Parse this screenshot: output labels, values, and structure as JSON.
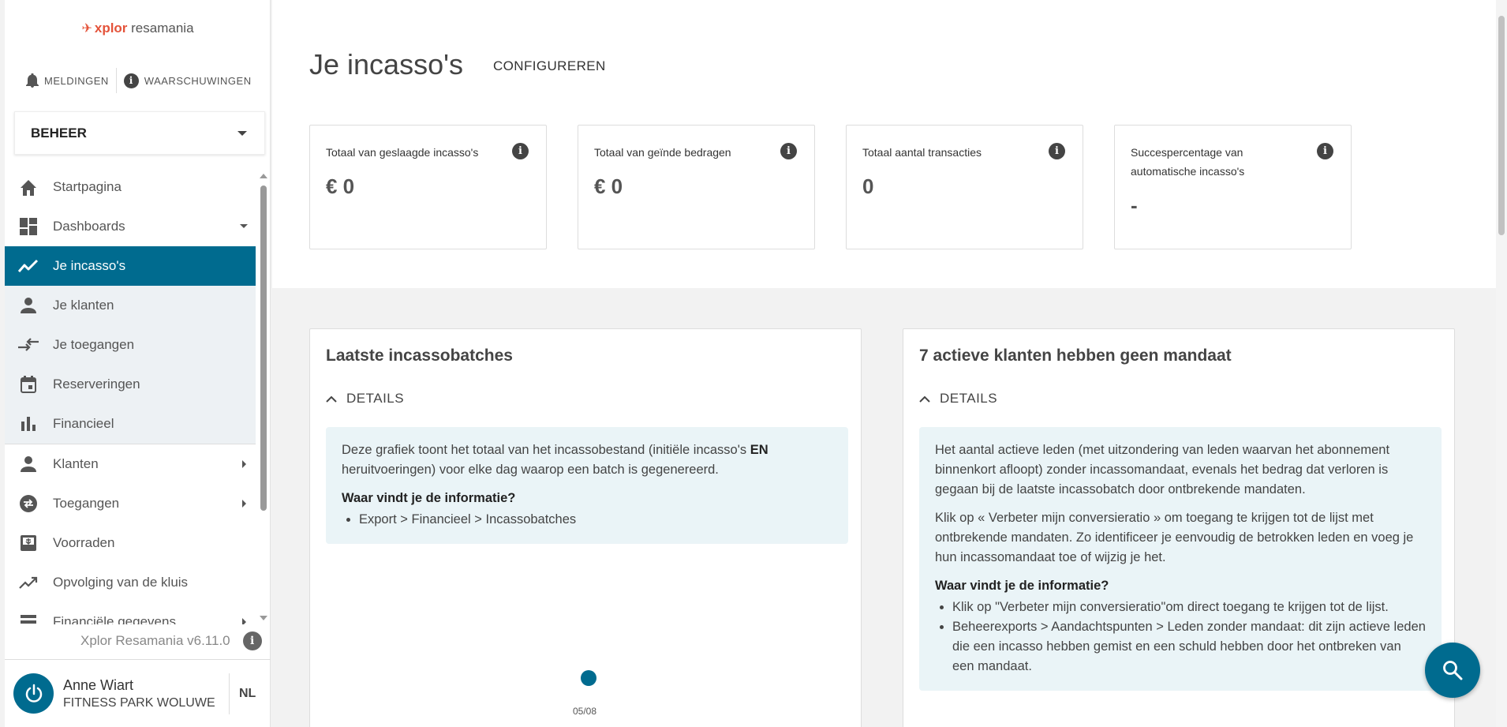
{
  "logo": {
    "brand": "xplor",
    "rest": " resamania"
  },
  "alerts": {
    "notifications": "MELDINGEN",
    "warnings": "WAARSCHUWINGEN"
  },
  "role_select": {
    "value": "BEHEER"
  },
  "sidebar": {
    "items": [
      {
        "label": "Startpagina",
        "icon": "home-icon"
      },
      {
        "label": "Dashboards",
        "icon": "dashboard-icon"
      },
      {
        "label": "Je incasso's",
        "icon": "trend-icon",
        "active": true
      },
      {
        "label": "Je klanten",
        "icon": "person-icon"
      },
      {
        "label": "Je toegangen",
        "icon": "swap-arrows-icon"
      },
      {
        "label": "Reserveringen",
        "icon": "calendar-icon"
      },
      {
        "label": "Financieel",
        "icon": "bar-chart-icon"
      },
      {
        "label": "Klanten",
        "icon": "person-icon"
      },
      {
        "label": "Toegangen",
        "icon": "swap-circle-icon"
      },
      {
        "label": "Voorraden",
        "icon": "inbox-icon"
      },
      {
        "label": "Opvolging van de kluis",
        "icon": "trending-up-icon"
      },
      {
        "label": "Financiële gegevens",
        "icon": "list-icon"
      }
    ]
  },
  "version": "Xplor Resamania v6.11.0",
  "user": {
    "name": "Anne Wiart",
    "club": "FITNESS PARK WOLUWE",
    "lang": "NL"
  },
  "header": {
    "title": "Je incasso's",
    "configure": "CONFIGUREREN"
  },
  "kpis": [
    {
      "label": "Totaal van geslaagde incasso's",
      "value": "€ 0"
    },
    {
      "label": "Totaal van geïnde bedragen",
      "value": "€ 0"
    },
    {
      "label": "Totaal aantal transacties",
      "value": "0"
    },
    {
      "label": "Succespercentage van automatische incasso's",
      "value": "-"
    }
  ],
  "panel_left": {
    "title": "Laatste incassobatches",
    "details": "DETAILS",
    "text_before": "Deze grafiek toont het totaal van het incassobestand (initiële incasso's ",
    "text_bold": "EN",
    "text_after": " heruitvoeringen) voor elke dag waarop een batch is gegenereerd.",
    "question": "Waar vindt je de informatie?",
    "bullets": [
      "Export > Financieel > Incassobatches"
    ],
    "chart_tick": "05/08"
  },
  "panel_right": {
    "title": "7 actieve klanten hebben geen mandaat",
    "details": "DETAILS",
    "para1": "Het aantal actieve leden (met uitzondering van leden waarvan het abonnement binnenkort afloopt) zonder incassomandaat, evenals het bedrag dat verloren is gegaan bij de laatste incassobatch door ontbrekende mandaten.",
    "para2": "Klik op « Verbeter mijn conversieratio » om toegang te krijgen tot de lijst met ontbrekende mandaten. Zo identificeer je eenvoudig de betrokken leden en voeg je hun incassomandaat toe of wijzig je het.",
    "question": "Waar vindt je de informatie?",
    "bullets": [
      "Klik op \"Verbeter mijn conversieratio\"om direct toegang te krijgen tot de lijst.",
      "Beheerexports > Aandachtspunten > Leden zonder mandaat: dit zijn actieve leden die een incasso hebben gemist en een schuld hebben door het ontbreken van een mandaat."
    ]
  },
  "colors": {
    "accent": "#006b8f",
    "info_bg": "#eaf4f7",
    "logo": "#e4533a"
  }
}
